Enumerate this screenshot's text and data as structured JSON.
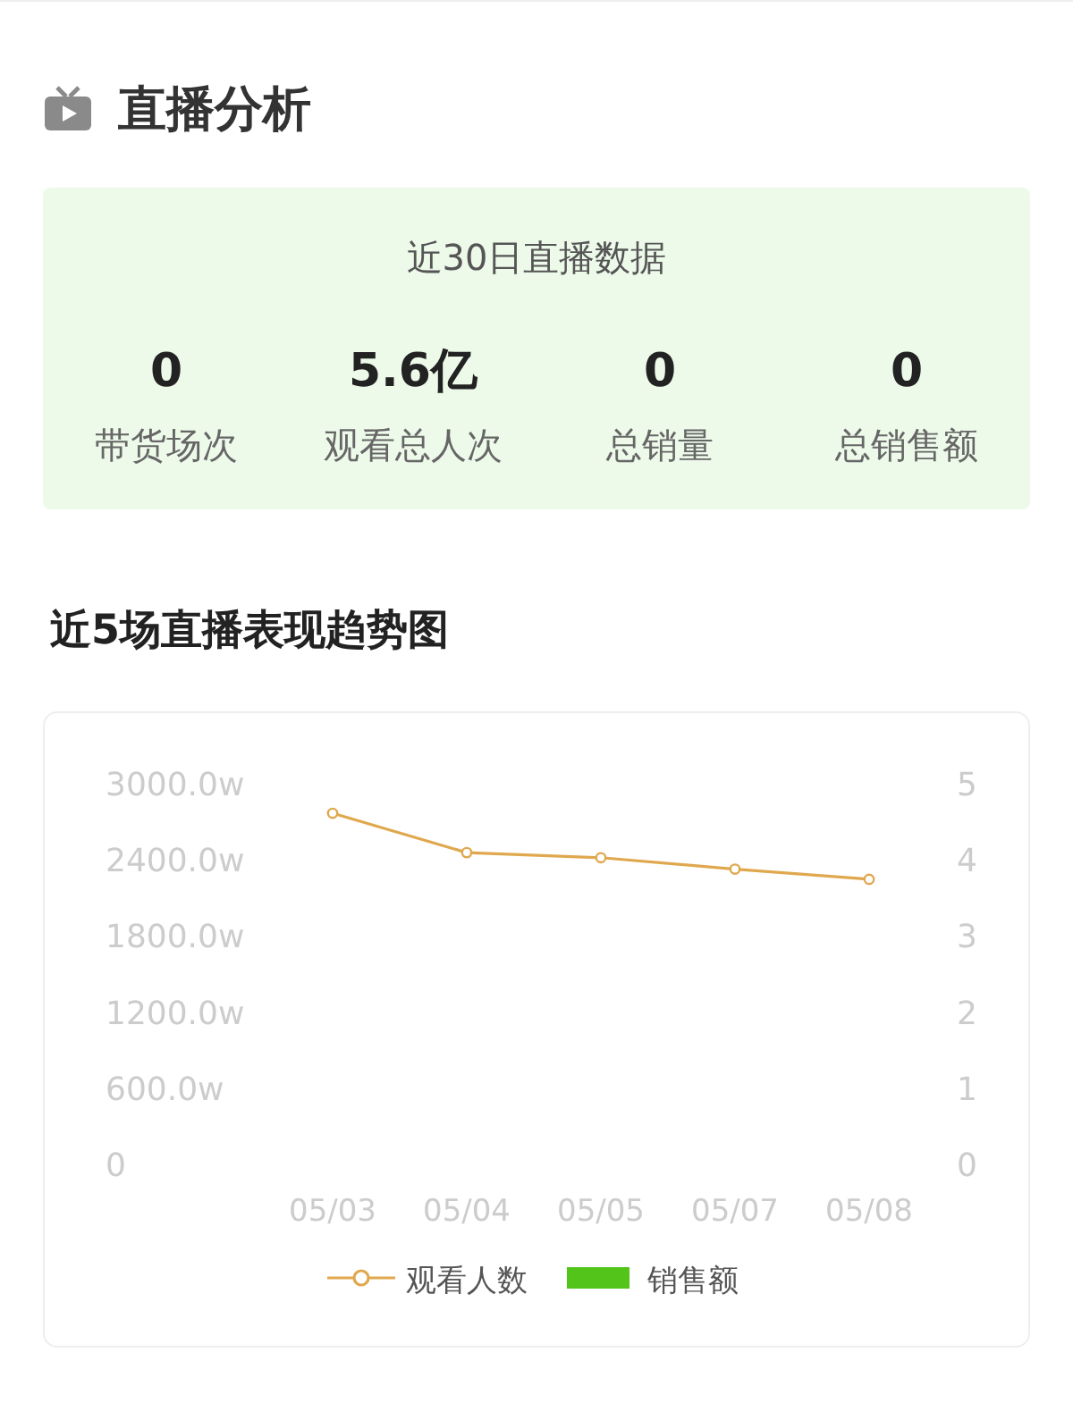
{
  "section": {
    "title": "直播分析"
  },
  "summary": {
    "title": "近30日直播数据",
    "stats": [
      {
        "value": "0",
        "label": "带货场次"
      },
      {
        "value": "5.6亿",
        "label": "观看总人次"
      },
      {
        "value": "0",
        "label": "总销量"
      },
      {
        "value": "0",
        "label": "总销售额"
      }
    ]
  },
  "trend": {
    "title": "近5场直播表现趋势图",
    "chart_data": {
      "type": "line",
      "categories": [
        "05/03",
        "05/04",
        "05/05",
        "05/07",
        "05/08"
      ],
      "series": [
        {
          "name": "观看人数",
          "color": "#e0a84e",
          "marker": "circle",
          "values": [
            2760,
            2450,
            2410,
            2320,
            2240
          ]
        },
        {
          "name": "销售额",
          "color": "#52c41a",
          "values": [
            null,
            null,
            null,
            null,
            null
          ]
        }
      ],
      "ylim": [
        0,
        3000
      ],
      "yticks": [
        {
          "value": 0,
          "label": "0"
        },
        {
          "value": 600,
          "label": "600.0w"
        },
        {
          "value": 1200,
          "label": "1200.0w"
        },
        {
          "value": 1800,
          "label": "1800.0w"
        },
        {
          "value": 2400,
          "label": "2400.0w"
        },
        {
          "value": 3000,
          "label": "3000.0w"
        }
      ],
      "y2ticks": [
        "0",
        "1",
        "2",
        "3",
        "4",
        "5"
      ]
    }
  }
}
